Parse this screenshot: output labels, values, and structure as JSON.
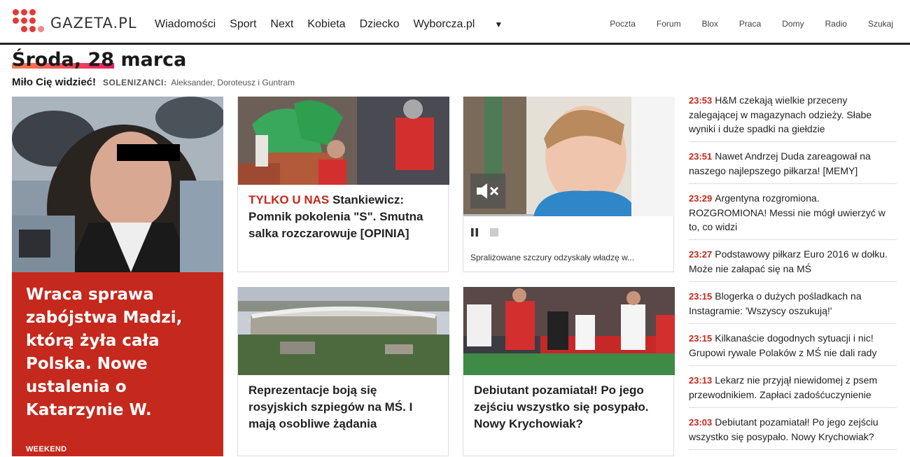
{
  "header": {
    "logo_text": "GAZETA.PL",
    "main_nav": [
      "Wiadomości",
      "Sport",
      "Next",
      "Kobieta",
      "Dziecko",
      "Wyborcza.pl"
    ],
    "sub_nav": [
      "Poczta",
      "Forum",
      "Blox",
      "Praca",
      "Domy",
      "Radio",
      "Szukaj"
    ]
  },
  "greeting": {
    "date_highlight": "Środa, 28",
    "date_rest": " marca",
    "hello": "Miło Cię widzieć!",
    "name_day_label": "SOLENIZANCI:",
    "name_day_names": "Aleksander, Doroteusz i Guntram"
  },
  "hero": {
    "title": "Wraca sprawa zabójstwa Madzi, którą żyła cała Polska. Nowe ustalenia o Katarzynie W.",
    "tag": "WEEKEND"
  },
  "cards": {
    "card1": {
      "kicker": "TYLKO U NAS",
      "title": " Stankiewicz: Pomnik pokolenia \"S\". Smutna salka rozczarowuje [OPINIA]"
    },
    "video": {
      "caption": "Spraliżowane szczury odzyskały władzę w..."
    },
    "card3": {
      "title": "Reprezentacje boją się rosyjskich szpiegów na MŚ. I mają osobliwe żądania"
    },
    "card4": {
      "title": "Debiutant pozamiatał! Po jego zejściu wszystko się posypało. Nowy Krychowiak?"
    }
  },
  "news": [
    {
      "time": "23:53",
      "text": "H&M czekają wielkie przeceny zalegającej w magazynach odzieży. Słabe wyniki i duże spadki na giełdzie"
    },
    {
      "time": "23:51",
      "text": "Nawet Andrzej Duda zareagował na naszego najlepszego piłkarza! [MEMY]"
    },
    {
      "time": "23:29",
      "text": "Argentyna rozgromiona. ROZGROMIONA! Messi nie mógł uwierzyć w to, co widzi"
    },
    {
      "time": "23:27",
      "text": "Podstawowy piłkarz Euro 2016 w dołku. Może nie załapać się na MŚ"
    },
    {
      "time": "23:15",
      "text": "Blogerka o dużych pośladkach na Instagramie: 'Wszyscy oszukują!'"
    },
    {
      "time": "23:15",
      "text": "Kilkanaście dogodnych sytuacji i nic! Grupowi rywale Polaków z MŚ nie dali rady"
    },
    {
      "time": "23:13",
      "text": "Lekarz nie przyjął niewidomej z psem przewodnikiem. Zapłaci zadośćuczynienie"
    },
    {
      "time": "23:03",
      "text": "Debiutant pozamiatał! Po jego zejściu wszystko się posypało. Nowy Krychowiak?"
    }
  ],
  "colors": {
    "brand_red": "#c5281c",
    "logo_red": "#e53935"
  }
}
